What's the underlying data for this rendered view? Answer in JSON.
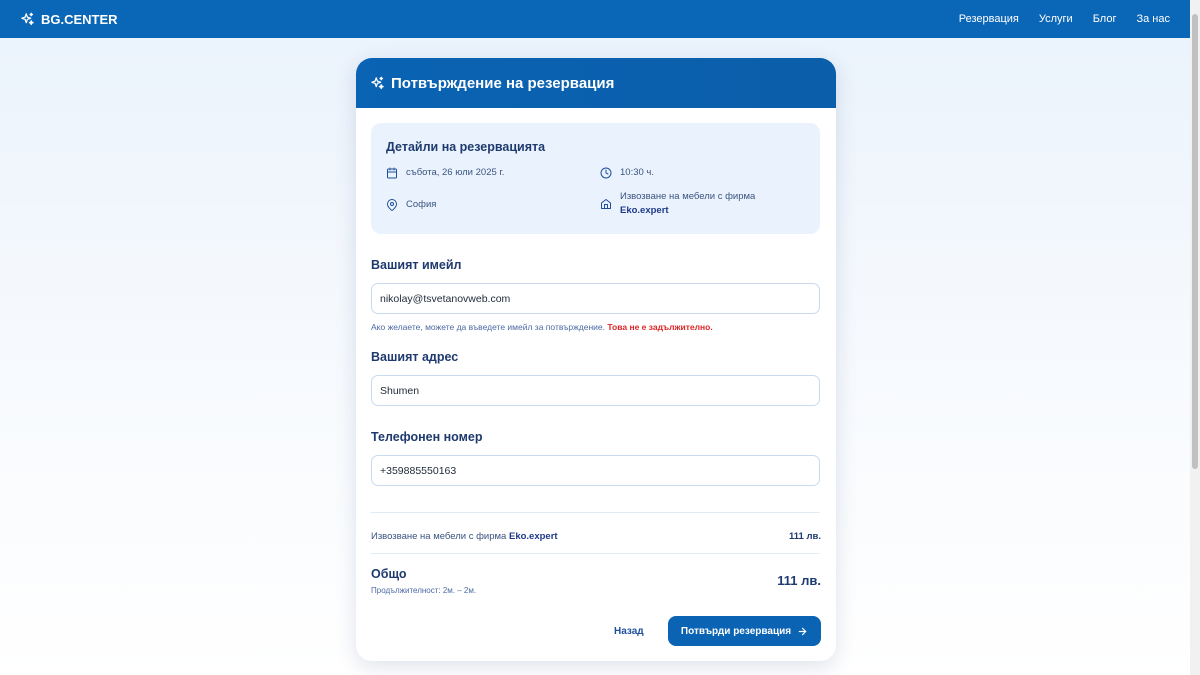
{
  "brand": {
    "name": "BG.CENTER",
    "icon": "sparkles-icon"
  },
  "nav": [
    "Резервация",
    "Услуги",
    "Блог",
    "За нас"
  ],
  "card": {
    "title": "Потвърждение на резервация",
    "icon": "sparkles-icon"
  },
  "details": {
    "heading": "Детайли на резервацията",
    "date": "събота, 26 юли 2025 г.",
    "time": "10:30 ч.",
    "city": "София",
    "service_prefix": "Извозване на мебели с фирма",
    "service_company": "Eko.expert"
  },
  "email": {
    "label": "Вашият имейл",
    "value": "nikolay@tsvetanovweb.com",
    "hint": "Ако желаете, можете да въведете имейл за потвърждение.",
    "hint_emphasis": "Това не е задължително."
  },
  "address": {
    "label": "Вашият адрес",
    "value": "Shumen"
  },
  "phone": {
    "label": "Телефонен номер",
    "value": "+359885550163"
  },
  "summary": {
    "item_prefix": "Извозване на мебели с фирма",
    "item_company": "Eko.expert",
    "item_price": "111 лв.",
    "total_label": "Общо",
    "total_price": "111 лв.",
    "duration": "Продължителност: 2м. – 2м."
  },
  "actions": {
    "back": "Назад",
    "confirm": "Потвърди резервация"
  },
  "colors": {
    "primary": "#0a66b7",
    "details_bg": "#eaf3fd",
    "warning": "#dc2626"
  }
}
